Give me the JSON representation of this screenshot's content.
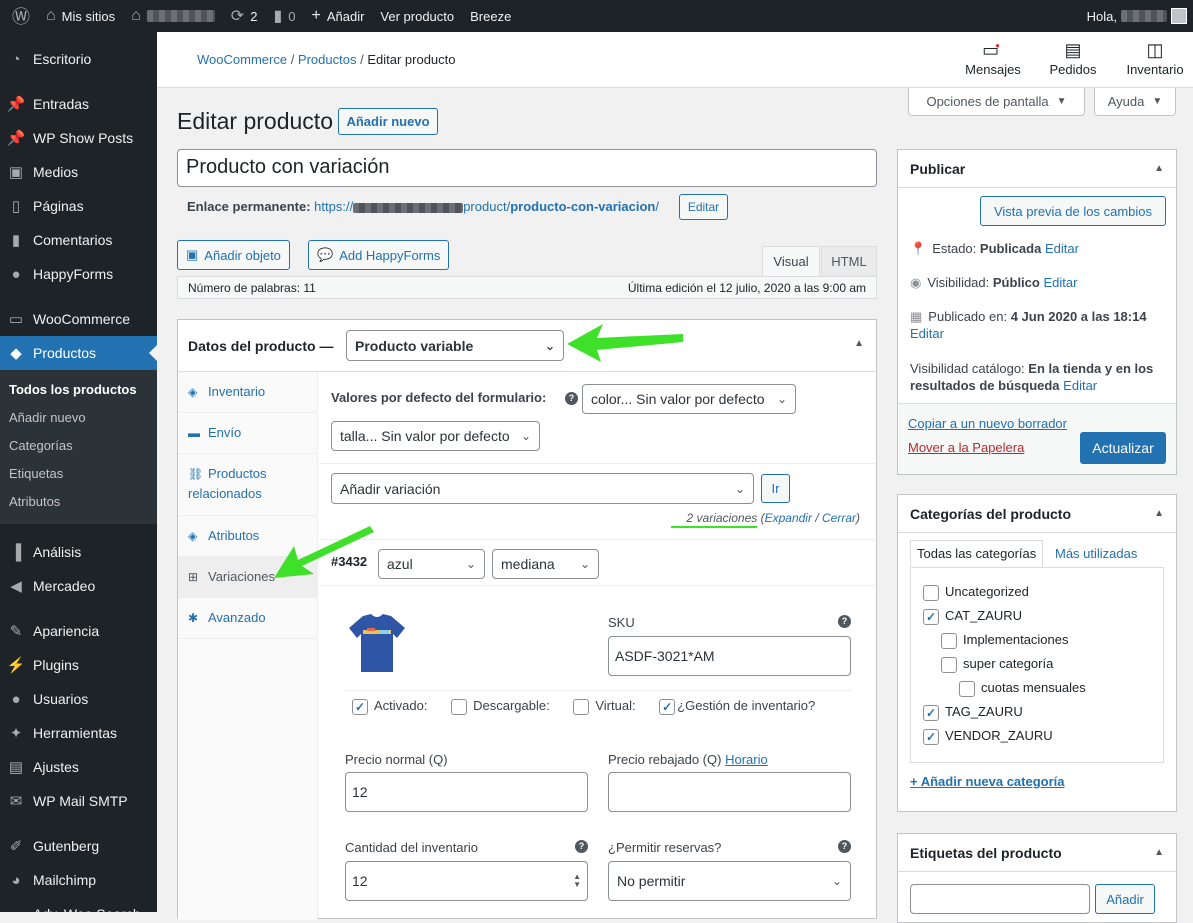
{
  "admin_bar": {
    "sites": "Mis sitios",
    "updates": "2",
    "comments": "0",
    "new": "Añadir",
    "view": "Ver producto",
    "breeze": "Breeze",
    "greeting": "Hola,"
  },
  "menu": {
    "items": [
      {
        "label": "Escritorio",
        "icon": "dashboard-icon"
      },
      {
        "label": "Entradas",
        "icon": "pin-icon"
      },
      {
        "label": "WP Show Posts",
        "icon": "pin-icon"
      },
      {
        "label": "Medios",
        "icon": "media-icon"
      },
      {
        "label": "Páginas",
        "icon": "page-icon"
      },
      {
        "label": "Comentarios",
        "icon": "comment-icon"
      },
      {
        "label": "HappyForms",
        "icon": "chat-icon"
      },
      {
        "label": "WooCommerce",
        "icon": "woo-icon"
      },
      {
        "label": "Productos",
        "icon": "box-icon"
      },
      {
        "label": "Análisis",
        "icon": "chart-icon"
      },
      {
        "label": "Mercadeo",
        "icon": "megaphone-icon"
      },
      {
        "label": "Apariencia",
        "icon": "brush-icon"
      },
      {
        "label": "Plugins",
        "icon": "plug-icon"
      },
      {
        "label": "Usuarios",
        "icon": "user-icon"
      },
      {
        "label": "Herramientas",
        "icon": "wrench-icon"
      },
      {
        "label": "Ajustes",
        "icon": "sliders-icon"
      },
      {
        "label": "WP Mail SMTP",
        "icon": "mail-icon"
      },
      {
        "label": "Gutenberg",
        "icon": "pen-icon"
      },
      {
        "label": "Mailchimp",
        "icon": "chimp-icon"
      },
      {
        "label": "Adv. Woo Search",
        "icon": "search-icon"
      }
    ],
    "submenu": [
      "Todos los productos",
      "Añadir nuevo",
      "Categorías",
      "Etiquetas",
      "Atributos"
    ]
  },
  "wc": {
    "crumb1": "WooCommerce",
    "crumb2": "Productos",
    "crumb3": "Editar producto",
    "messages": "Mensajes",
    "orders": "Pedidos",
    "inventory": "Inventario"
  },
  "screen_options": "Opciones de pantalla",
  "help": "Ayuda",
  "page_title": "Editar producto",
  "add_new": "Añadir nuevo",
  "product_title": "Producto con variación",
  "permalink": {
    "label": "Enlace permanente:",
    "url_start": "https://",
    "url_mid": "product/",
    "url_slug": "producto-con-variacion",
    "url_end": "/",
    "edit": "Editar"
  },
  "editor": {
    "add_object": "Añadir objeto",
    "add_happyforms": "Add HappyForms",
    "visual": "Visual",
    "html": "HTML",
    "word_count": "Número de palabras: 11",
    "last_edit": "Última edición el 12 julio, 2020 a las 9:00 am"
  },
  "product_data": {
    "label": "Datos del producto —",
    "type": "Producto variable",
    "tabs": [
      "Inventario",
      "Envío",
      "Productos relacionados",
      "Atributos",
      "Variaciones",
      "Avanzado"
    ],
    "defaults_label": "Valores por defecto del formulario:",
    "default_color": "color... Sin valor por defecto",
    "default_size": "talla... Sin valor por defecto",
    "add_variation": "Añadir variación",
    "go": "Ir",
    "count": "2 variaciones",
    "expand": "Expandir",
    "close": "Cerrar",
    "variation": {
      "id": "#3432",
      "color": "azul",
      "size": "mediana",
      "sku_label": "SKU",
      "sku": "ASDF-3021*AM",
      "enabled": "Activado:",
      "downloadable": "Descargable:",
      "virtual": "Virtual:",
      "manage_stock": "¿Gestión de inventario?",
      "regular_price_label": "Precio normal (Q)",
      "regular_price": "12",
      "sale_price_label": "Precio rebajado (Q)",
      "schedule": "Horario",
      "stock_qty_label": "Cantidad del inventario",
      "stock_qty": "12",
      "backorders_label": "¿Permitir reservas?",
      "backorders": "No permitir"
    }
  },
  "publish": {
    "title": "Publicar",
    "preview": "Vista previa de los cambios",
    "status_label": "Estado:",
    "status": "Publicada",
    "visibility_label": "Visibilidad:",
    "visibility": "Público",
    "published_label": "Publicado en:",
    "published": "4 Jun 2020 a las 18:14",
    "catalog_label": "Visibilidad catálogo:",
    "catalog": "En la tienda y en los resultados de búsqueda",
    "edit": "Editar",
    "copy": "Copiar a un nuevo borrador",
    "trash": "Mover a la Papelera",
    "update": "Actualizar"
  },
  "categories": {
    "title": "Categorías del producto",
    "tab_all": "Todas las categorías",
    "tab_used": "Más utilizadas",
    "items": [
      {
        "label": "Uncategorized",
        "checked": false
      },
      {
        "label": "CAT_ZAURU",
        "checked": true
      },
      {
        "label": "Implementaciones",
        "checked": false
      },
      {
        "label": "super categoría",
        "checked": false
      },
      {
        "label": "cuotas mensuales",
        "checked": false
      },
      {
        "label": "TAG_ZAURU",
        "checked": true
      },
      {
        "label": "VENDOR_ZAURU",
        "checked": true
      }
    ],
    "add": "+ Añadir nueva categoría"
  },
  "tags": {
    "title": "Etiquetas del producto",
    "add": "Añadir"
  },
  "colors": {
    "accent": "#2271b1",
    "arrow": "#3ee02a",
    "sidebar": "#1d2327"
  }
}
